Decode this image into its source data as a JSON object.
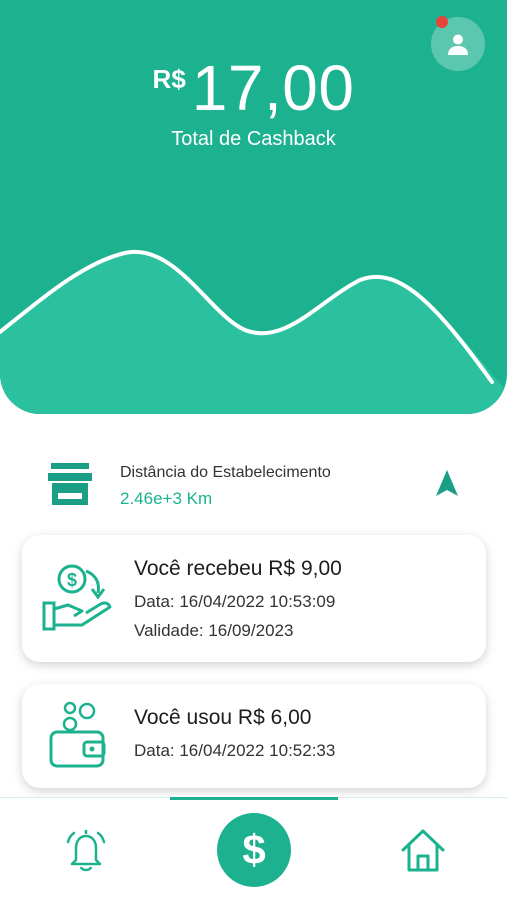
{
  "header": {
    "currency_symbol": "R$",
    "cashback_amount": "17,00",
    "cashback_label": "Total de Cashback",
    "profile_icon": "user-icon",
    "notification_dot": true
  },
  "distance": {
    "title": "Distância do Estabelecimento",
    "value": "2.46e+3 Km",
    "store_icon": "store-icon",
    "nav_icon": "navigation-arrow-icon"
  },
  "transactions": [
    {
      "icon": "cashback-hand-icon",
      "title": "Você recebeu R$ 9,00",
      "date": "Data: 16/04/2022 10:53:09",
      "validity": "Validade: 16/09/2023"
    },
    {
      "icon": "wallet-coins-icon",
      "title": "Você usou R$ 6,00",
      "date": "Data: 16/04/2022 10:52:33"
    }
  ],
  "bottom_nav": {
    "items": [
      {
        "name": "notifications",
        "icon": "bell-icon"
      },
      {
        "name": "cashback",
        "icon": "dollar-icon",
        "label": "$",
        "active": true
      },
      {
        "name": "home",
        "icon": "home-icon"
      }
    ]
  },
  "colors": {
    "primary": "#1db28f",
    "wave_fill": "#2bc19f",
    "notification": "#e8443a"
  }
}
